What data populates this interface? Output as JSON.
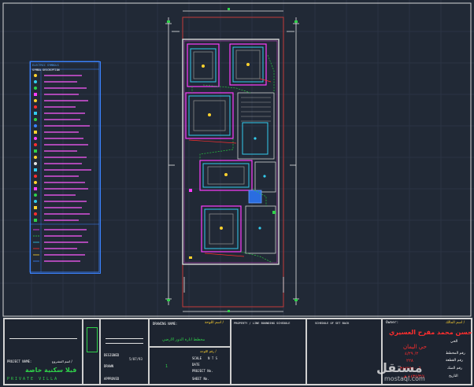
{
  "legend": {
    "title": "ELECTRIC SYMBOLS",
    "subtitle": "SYMBOL DESCRIPTION"
  },
  "title_block": {
    "drawing_name_label": "DRAWING NAME:",
    "drawing_name_ar_label": "اسم اللوحة /",
    "drawing_name_value": "مخطط انارة الدور الارضي",
    "property_schedule_label": "PROPERTY / LINE BOUNDING SCHEDULE",
    "setback_label": "SCHEDULE OF SET BACK",
    "design_label": "DESIGNED",
    "drawn_label": "DRAWN",
    "approved_label": "APPROVED",
    "project_name_label": "PROJECT NAME:",
    "project_name_ar_label": "اسم المشروع /",
    "project_name_value": "فيلا سكنية خاصة",
    "project_name_en": "PRIVATE VILLA",
    "scale_label": "SCALE",
    "scale_value": "N T S",
    "date_label": "DATE",
    "project_no_label": "PROJECT No.",
    "sheet_label": "SHEET No.",
    "sheet_value": "1",
    "sheet_ar_label": "رقم اللوحة /",
    "owner_label": "Owner:",
    "owner_ar_label": "اسم المالك /",
    "owner_value": "حسن محمد مفرح العسيري",
    "district_label": "الحي",
    "district_value": "حي اليمان",
    "plan_label": "رقم المخطط",
    "plan_value": "٢/ ٤/٢٩",
    "parcel_label": "رقم القطعة",
    "parcel_value": "٢٢٨",
    "deed_label": "رقم الصك",
    "deed_value": "٣٨٧٩٩٥٠٠٦",
    "deed_date_label": "التاريخ",
    "deed_date_value": "١٤٣٥/٣/٤ هـ",
    "small_value": "5/07/93"
  },
  "watermark": {
    "text": "مستقل",
    "url": "mostaql.com"
  }
}
